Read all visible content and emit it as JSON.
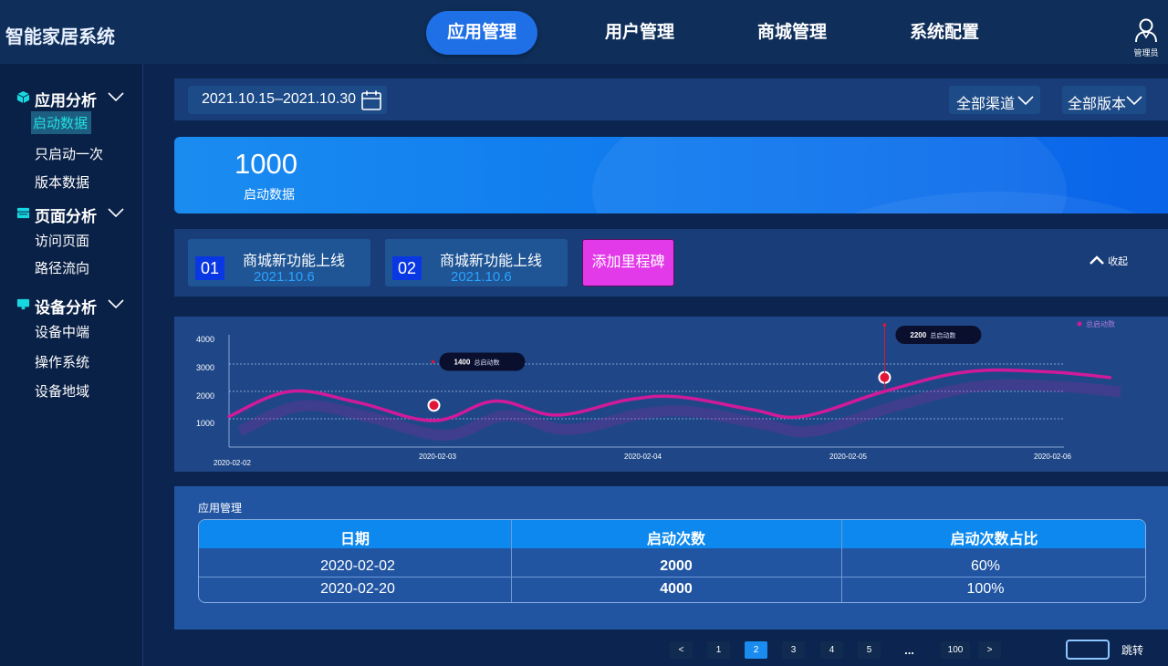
{
  "header": {
    "title": "智能家居系统",
    "tabs": [
      {
        "label": "应用管理",
        "active": true
      },
      {
        "label": "用户管理",
        "active": false
      },
      {
        "label": "商城管理",
        "active": false
      },
      {
        "label": "系统配置",
        "active": false
      }
    ],
    "user_label": "管理员"
  },
  "sidebar": {
    "groups": [
      {
        "label": "应用分析",
        "icon": "cube-icon",
        "items": [
          {
            "label": "启动数据",
            "active": true
          },
          {
            "label": "只启动一次",
            "active": false
          },
          {
            "label": "版本数据",
            "active": false
          }
        ]
      },
      {
        "label": "页面分析",
        "icon": "layers-icon",
        "items": [
          {
            "label": "访问页面",
            "active": false
          },
          {
            "label": "路径流向",
            "active": false
          }
        ]
      },
      {
        "label": "设备分析",
        "icon": "monitor-icon",
        "items": [
          {
            "label": "设备中端",
            "active": false
          },
          {
            "label": "操作系统",
            "active": false
          },
          {
            "label": "设备地域",
            "active": false
          }
        ]
      }
    ]
  },
  "filters": {
    "date_range": "2021.10.15–2021.10.30",
    "channel": "全部渠道",
    "version": "全部版本"
  },
  "summary": {
    "value": "1000",
    "label": "启动数据"
  },
  "milestones": {
    "items": [
      {
        "index": "01",
        "title": "商城新功能上线",
        "date": "2021.10.6"
      },
      {
        "index": "02",
        "title": "商城新功能上线",
        "date": "2021.10.6"
      }
    ],
    "add_label": "添加里程碑",
    "collapse_label": "收起"
  },
  "chart_data": {
    "type": "line",
    "x_ticks": [
      "2020-02-02",
      "2020-02-03",
      "2020-02-04",
      "2020-02-05",
      "2020-02-06"
    ],
    "y_ticks": [
      "1000",
      "2000",
      "3000",
      "4000"
    ],
    "ylim": [
      0,
      4000
    ],
    "legend": "总启动数",
    "series": [
      {
        "name": "总启动数",
        "points": [
          [
            0.0,
            1100
          ],
          [
            0.3,
            2000
          ],
          [
            0.63,
            1600
          ],
          [
            1.0,
            950
          ],
          [
            1.3,
            1650
          ],
          [
            1.6,
            1150
          ],
          [
            1.95,
            1700
          ],
          [
            2.2,
            1800
          ],
          [
            2.55,
            1350
          ],
          [
            2.8,
            1100
          ],
          [
            3.2,
            2000
          ],
          [
            3.6,
            2700
          ],
          [
            4.0,
            2700
          ],
          [
            4.3,
            2500
          ]
        ]
      }
    ],
    "markers": [
      {
        "x": 1.0,
        "y": 1500
      },
      {
        "x": 3.2,
        "y": 2500
      }
    ],
    "tooltips": [
      {
        "x": 1.0,
        "y": 3000,
        "value": "1400",
        "label": "总启动数"
      },
      {
        "x": 3.2,
        "y": 4000,
        "value": "2200",
        "label": "总启动数"
      }
    ],
    "color": "#d11a9a"
  },
  "table": {
    "section_title": "应用管理",
    "headers": [
      "日期",
      "启动次数",
      "启动次数占比"
    ],
    "rows": [
      [
        "2020-02-02",
        "2000",
        "60%"
      ],
      [
        "2020-02-20",
        "4000",
        "100%"
      ]
    ]
  },
  "pagination": {
    "prev": "<",
    "pages": [
      "1",
      "2",
      "3",
      "4",
      "5"
    ],
    "active_page": "2",
    "dots": "...",
    "last": "100",
    "next": ">",
    "jump_label": "跳转"
  },
  "colors": {
    "accent": "#1a8cf0",
    "active_tab": "#1f6fe6",
    "add_button": "#e33ae9",
    "line": "#d11a9a",
    "sidebar_active_text": "#22e0e0"
  }
}
